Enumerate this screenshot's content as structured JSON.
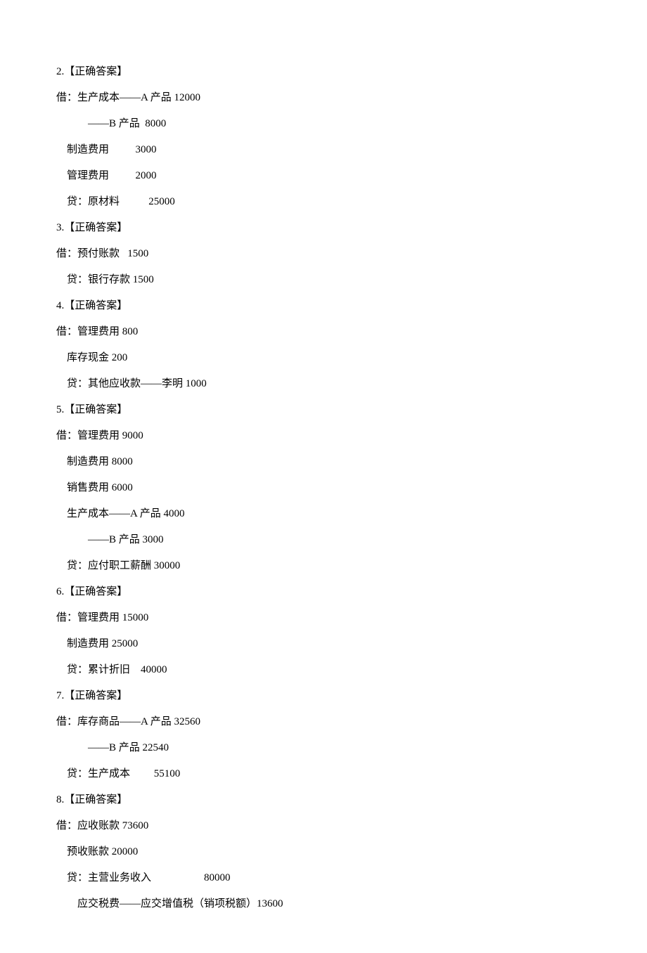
{
  "lines": [
    "2.【正确答案】",
    "借：生产成本——A 产品 12000",
    "            ——B 产品  8000",
    "    制造费用          3000",
    "    管理费用          2000",
    "    贷：原材料           25000",
    "3.【正确答案】",
    "借：预付账款   1500",
    "    贷：银行存款 1500",
    "4.【正确答案】",
    "借：管理费用 800",
    "    库存现金 200",
    "    贷：其他应收款——李明 1000",
    "5.【正确答案】",
    "借：管理费用 9000",
    "    制造费用 8000",
    "    销售费用 6000",
    "    生产成本——A 产品 4000",
    "            ——B 产品 3000",
    "    贷：应付职工薪酬 30000",
    "6.【正确答案】",
    "借：管理费用 15000",
    "    制造费用 25000",
    "    贷：累计折旧    40000",
    "7.【正确答案】",
    "借：库存商品——A 产品 32560",
    "            ——B 产品 22540",
    "    贷：生产成本         55100",
    "8.【正确答案】",
    "借：应收账款 73600",
    "    预收账款 20000",
    "    贷：主营业务收入                    80000",
    "        应交税费——应交增值税（销项税额）13600"
  ]
}
